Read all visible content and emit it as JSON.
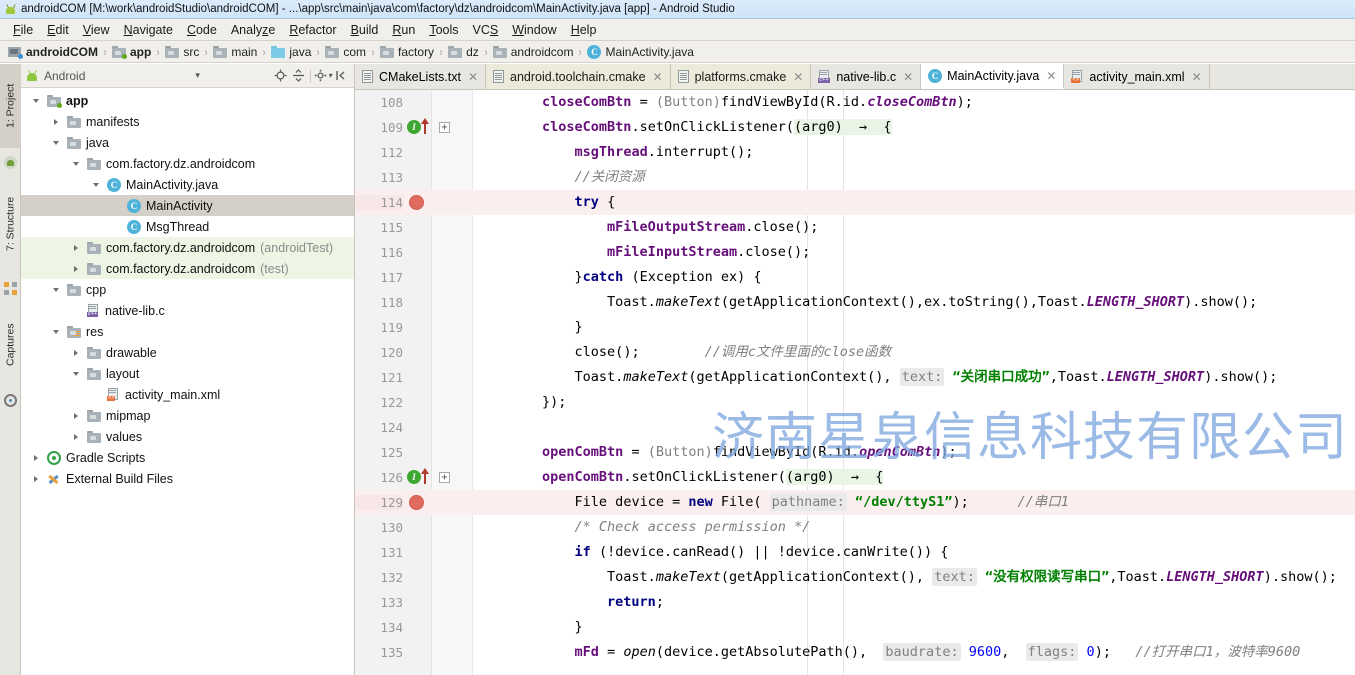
{
  "window": {
    "title": "androidCOM [M:\\work\\androidStudio\\androidCOM] - ...\\app\\src\\main\\java\\com\\factory\\dz\\androidcom\\MainActivity.java [app] - Android Studio",
    "app_icon": "android-studio-icon"
  },
  "menubar": {
    "items": [
      {
        "label": "File",
        "mnemonic": "F"
      },
      {
        "label": "Edit",
        "mnemonic": "E"
      },
      {
        "label": "View",
        "mnemonic": "V"
      },
      {
        "label": "Navigate",
        "mnemonic": "N"
      },
      {
        "label": "Code",
        "mnemonic": "C"
      },
      {
        "label": "Analyze",
        "mnemonic": "z"
      },
      {
        "label": "Refactor",
        "mnemonic": "R"
      },
      {
        "label": "Build",
        "mnemonic": "B"
      },
      {
        "label": "Run",
        "mnemonic": "R"
      },
      {
        "label": "Tools",
        "mnemonic": "T"
      },
      {
        "label": "VCS",
        "mnemonic": "S"
      },
      {
        "label": "Window",
        "mnemonic": "W"
      },
      {
        "label": "Help",
        "mnemonic": "H"
      }
    ]
  },
  "breadcrumb": {
    "items": [
      {
        "label": "androidCOM",
        "icon": "project-icon",
        "bold": true
      },
      {
        "label": "app",
        "icon": "module-folder-icon",
        "bold": true
      },
      {
        "label": "src",
        "icon": "folder-icon",
        "bold": false
      },
      {
        "label": "main",
        "icon": "folder-icon",
        "bold": false
      },
      {
        "label": "java",
        "icon": "source-folder-icon",
        "bold": false
      },
      {
        "label": "com",
        "icon": "package-folder-icon",
        "bold": false
      },
      {
        "label": "factory",
        "icon": "package-folder-icon",
        "bold": false
      },
      {
        "label": "dz",
        "icon": "package-folder-icon",
        "bold": false
      },
      {
        "label": "androidcom",
        "icon": "package-folder-icon",
        "bold": false
      },
      {
        "label": "MainActivity.java",
        "icon": "java-class-icon",
        "bold": false
      }
    ],
    "separator": "›"
  },
  "toolstrip": {
    "left_tabs": [
      {
        "label": "1: Project",
        "active": true
      },
      {
        "label": "7: Structure",
        "active": false
      },
      {
        "label": "Captures",
        "active": false
      }
    ]
  },
  "project_panel": {
    "header": {
      "title": "Android",
      "dropdown_arrow": "chevron-down-icon",
      "buttons": [
        "locate-icon",
        "collapse-all-icon",
        "settings-icon",
        "hide-icon"
      ]
    },
    "tree": [
      {
        "label": "app",
        "indent": 0,
        "expander": "down",
        "icon": "module-folder-icon",
        "bold": true,
        "dim": "",
        "state": ""
      },
      {
        "label": "manifests",
        "indent": 1,
        "expander": "right",
        "icon": "folder-icon",
        "bold": false,
        "dim": "",
        "state": ""
      },
      {
        "label": "java",
        "indent": 1,
        "expander": "down",
        "icon": "folder-icon",
        "bold": false,
        "dim": "",
        "state": ""
      },
      {
        "label": "com.factory.dz.androidcom",
        "indent": 2,
        "expander": "down",
        "icon": "package-folder-icon",
        "bold": false,
        "dim": "",
        "state": ""
      },
      {
        "label": "MainActivity.java",
        "indent": 3,
        "expander": "down",
        "icon": "java-class-icon",
        "bold": false,
        "dim": "",
        "state": ""
      },
      {
        "label": "MainActivity",
        "indent": 4,
        "expander": "none",
        "icon": "java-class-icon",
        "bold": false,
        "dim": "",
        "state": "selected"
      },
      {
        "label": "MsgThread",
        "indent": 4,
        "expander": "none",
        "icon": "java-class-icon",
        "bold": false,
        "dim": "",
        "state": ""
      },
      {
        "label": "com.factory.dz.androidcom",
        "indent": 2,
        "expander": "right",
        "icon": "package-folder-icon",
        "bold": false,
        "dim": "(androidTest)",
        "state": "test"
      },
      {
        "label": "com.factory.dz.androidcom",
        "indent": 2,
        "expander": "right",
        "icon": "package-folder-icon",
        "bold": false,
        "dim": "(test)",
        "state": "test"
      },
      {
        "label": "cpp",
        "indent": 1,
        "expander": "down",
        "icon": "folder-icon",
        "bold": false,
        "dim": "",
        "state": ""
      },
      {
        "label": "native-lib.c",
        "indent": 2,
        "expander": "none",
        "icon": "cpp-file-icon",
        "bold": false,
        "dim": "",
        "state": ""
      },
      {
        "label": "res",
        "indent": 1,
        "expander": "down",
        "icon": "res-folder-icon",
        "bold": false,
        "dim": "",
        "state": ""
      },
      {
        "label": "drawable",
        "indent": 2,
        "expander": "right",
        "icon": "package-folder-icon",
        "bold": false,
        "dim": "",
        "state": ""
      },
      {
        "label": "layout",
        "indent": 2,
        "expander": "down",
        "icon": "package-folder-icon",
        "bold": false,
        "dim": "",
        "state": ""
      },
      {
        "label": "activity_main.xml",
        "indent": 3,
        "expander": "none",
        "icon": "xml-file-icon",
        "bold": false,
        "dim": "",
        "state": ""
      },
      {
        "label": "mipmap",
        "indent": 2,
        "expander": "right",
        "icon": "package-folder-icon",
        "bold": false,
        "dim": "",
        "state": ""
      },
      {
        "label": "values",
        "indent": 2,
        "expander": "right",
        "icon": "package-folder-icon",
        "bold": false,
        "dim": "",
        "state": ""
      },
      {
        "label": "Gradle Scripts",
        "indent": 0,
        "expander": "right",
        "icon": "gradle-icon",
        "bold": false,
        "dim": "",
        "state": ""
      },
      {
        "label": "External Build Files",
        "indent": 0,
        "expander": "right",
        "icon": "external-build-icon",
        "bold": false,
        "dim": "",
        "state": ""
      }
    ]
  },
  "editor_tabs": [
    {
      "label": "CMakeLists.txt",
      "icon": "cmake-file-icon",
      "style": "plain",
      "active": false
    },
    {
      "label": "android.toolchain.cmake",
      "icon": "cmake-file-icon",
      "style": "cmake",
      "active": false
    },
    {
      "label": "platforms.cmake",
      "icon": "cmake-file-icon",
      "style": "cmake",
      "active": false
    },
    {
      "label": "native-lib.c",
      "icon": "cpp-file-icon",
      "style": "plain",
      "active": false
    },
    {
      "label": "MainActivity.java",
      "icon": "java-class-icon",
      "style": "plain",
      "active": true
    },
    {
      "label": "activity_main.xml",
      "icon": "xml-file-icon",
      "style": "plain",
      "active": false
    }
  ],
  "watermark": "济南星泉信息科技有限公司",
  "editor": {
    "lines": [
      {
        "num": "108",
        "hl": false,
        "gutter": "",
        "fold": false,
        "tokens": [
          {
            "t": "        ",
            "c": "plain"
          },
          {
            "t": "closeComBtn",
            "c": "fld"
          },
          {
            "t": " = ",
            "c": "plain"
          },
          {
            "t": "(Button)",
            "c": "cast"
          },
          {
            "t": "findViewById(R.",
            "c": "plain"
          },
          {
            "t": "id",
            "c": "plain"
          },
          {
            "t": ".",
            "c": "plain"
          },
          {
            "t": "closeComBtn",
            "c": "stat"
          },
          {
            "t": ");",
            "c": "plain"
          }
        ]
      },
      {
        "num": "109",
        "hl": false,
        "gutter": "run",
        "fold": true,
        "tokens": [
          {
            "t": "        ",
            "c": "plain"
          },
          {
            "t": "closeComBtn",
            "c": "fld"
          },
          {
            "t": ".setOnClickListener(",
            "c": "plain"
          },
          {
            "t": "(arg0)  →  {",
            "c": "lamb"
          }
        ]
      },
      {
        "num": "112",
        "hl": false,
        "gutter": "",
        "fold": false,
        "tokens": [
          {
            "t": "            ",
            "c": "plain"
          },
          {
            "t": "msgThread",
            "c": "fld"
          },
          {
            "t": ".interrupt();",
            "c": "plain"
          }
        ]
      },
      {
        "num": "113",
        "hl": false,
        "gutter": "",
        "fold": false,
        "tokens": [
          {
            "t": "            ",
            "c": "plain"
          },
          {
            "t": "//关闭资源",
            "c": "cmt"
          }
        ]
      },
      {
        "num": "114",
        "hl": true,
        "gutter": "bp",
        "fold": false,
        "tokens": [
          {
            "t": "            ",
            "c": "plain"
          },
          {
            "t": "try",
            "c": "kw"
          },
          {
            "t": " {",
            "c": "plain"
          }
        ]
      },
      {
        "num": "115",
        "hl": false,
        "gutter": "",
        "fold": false,
        "tokens": [
          {
            "t": "                ",
            "c": "plain"
          },
          {
            "t": "mFileOutputStream",
            "c": "fld"
          },
          {
            "t": ".close();",
            "c": "plain"
          }
        ]
      },
      {
        "num": "116",
        "hl": false,
        "gutter": "",
        "fold": false,
        "tokens": [
          {
            "t": "                ",
            "c": "plain"
          },
          {
            "t": "mFileInputStream",
            "c": "fld"
          },
          {
            "t": ".close();",
            "c": "plain"
          }
        ]
      },
      {
        "num": "117",
        "hl": false,
        "gutter": "",
        "fold": false,
        "tokens": [
          {
            "t": "            }",
            "c": "plain"
          },
          {
            "t": "catch",
            "c": "kw"
          },
          {
            "t": " (Exception ex) {",
            "c": "plain"
          }
        ]
      },
      {
        "num": "118",
        "hl": false,
        "gutter": "",
        "fold": false,
        "tokens": [
          {
            "t": "                ",
            "c": "plain"
          },
          {
            "t": "Toast.",
            "c": "plain"
          },
          {
            "t": "makeText",
            "c": "mth"
          },
          {
            "t": "(getApplicationContext(),ex.toString(),Toast.",
            "c": "plain"
          },
          {
            "t": "LENGTH_SHORT",
            "c": "stat"
          },
          {
            "t": ").show();",
            "c": "plain"
          }
        ]
      },
      {
        "num": "119",
        "hl": false,
        "gutter": "",
        "fold": false,
        "tokens": [
          {
            "t": "            }",
            "c": "plain"
          }
        ]
      },
      {
        "num": "120",
        "hl": false,
        "gutter": "",
        "fold": false,
        "tokens": [
          {
            "t": "            ",
            "c": "plain"
          },
          {
            "t": "close();",
            "c": "plain"
          },
          {
            "t": "        ",
            "c": "plain"
          },
          {
            "t": "//调用c文件里面的close函数",
            "c": "cmt"
          }
        ]
      },
      {
        "num": "121",
        "hl": false,
        "gutter": "",
        "fold": false,
        "tokens": [
          {
            "t": "            ",
            "c": "plain"
          },
          {
            "t": "Toast.",
            "c": "plain"
          },
          {
            "t": "makeText",
            "c": "mth"
          },
          {
            "t": "(getApplicationContext(), ",
            "c": "plain"
          },
          {
            "t": "text:",
            "c": "hint"
          },
          {
            "t": " ",
            "c": "plain"
          },
          {
            "t": "“关闭串口成功”",
            "c": "str"
          },
          {
            "t": ",Toast.",
            "c": "plain"
          },
          {
            "t": "LENGTH_SHORT",
            "c": "stat"
          },
          {
            "t": ").show();",
            "c": "plain"
          }
        ]
      },
      {
        "num": "122",
        "hl": false,
        "gutter": "",
        "fold": false,
        "tokens": [
          {
            "t": "        ",
            "c": "plain"
          },
          {
            "t": "});",
            "c": "plain"
          }
        ]
      },
      {
        "num": "124",
        "hl": false,
        "gutter": "",
        "fold": false,
        "tokens": []
      },
      {
        "num": "125",
        "hl": false,
        "gutter": "",
        "fold": false,
        "tokens": [
          {
            "t": "        ",
            "c": "plain"
          },
          {
            "t": "openComBtn",
            "c": "fld"
          },
          {
            "t": " = ",
            "c": "plain"
          },
          {
            "t": "(Button)",
            "c": "cast"
          },
          {
            "t": "findViewById(R.",
            "c": "plain"
          },
          {
            "t": "id",
            "c": "plain"
          },
          {
            "t": ".",
            "c": "plain"
          },
          {
            "t": "openComBtn",
            "c": "stat"
          },
          {
            "t": ");",
            "c": "plain"
          }
        ]
      },
      {
        "num": "126",
        "hl": false,
        "gutter": "run",
        "fold": true,
        "tokens": [
          {
            "t": "        ",
            "c": "plain"
          },
          {
            "t": "openComBtn",
            "c": "fld"
          },
          {
            "t": ".setOnClickListener(",
            "c": "plain"
          },
          {
            "t": "(arg0)  →  {",
            "c": "lamb"
          }
        ]
      },
      {
        "num": "129",
        "hl": true,
        "gutter": "bp",
        "fold": false,
        "tokens": [
          {
            "t": "            ",
            "c": "plain"
          },
          {
            "t": "File device = ",
            "c": "plain"
          },
          {
            "t": "new",
            "c": "kw"
          },
          {
            "t": " File( ",
            "c": "plain"
          },
          {
            "t": "pathname:",
            "c": "hint"
          },
          {
            "t": " ",
            "c": "plain"
          },
          {
            "t": "“/dev/ttyS1”",
            "c": "str"
          },
          {
            "t": ");",
            "c": "plain"
          },
          {
            "t": "      ",
            "c": "plain"
          },
          {
            "t": "//串口1",
            "c": "cmt"
          }
        ]
      },
      {
        "num": "130",
        "hl": false,
        "gutter": "",
        "fold": false,
        "tokens": [
          {
            "t": "            ",
            "c": "plain"
          },
          {
            "t": "/* Check access permission */",
            "c": "cmt"
          }
        ]
      },
      {
        "num": "131",
        "hl": false,
        "gutter": "",
        "fold": false,
        "tokens": [
          {
            "t": "            ",
            "c": "plain"
          },
          {
            "t": "if",
            "c": "kw"
          },
          {
            "t": " (!device.canRead() || !device.canWrite()) {",
            "c": "plain"
          }
        ]
      },
      {
        "num": "132",
        "hl": false,
        "gutter": "",
        "fold": false,
        "tokens": [
          {
            "t": "                ",
            "c": "plain"
          },
          {
            "t": "Toast.",
            "c": "plain"
          },
          {
            "t": "makeText",
            "c": "mth"
          },
          {
            "t": "(getApplicationContext(), ",
            "c": "plain"
          },
          {
            "t": "text:",
            "c": "hint"
          },
          {
            "t": " ",
            "c": "plain"
          },
          {
            "t": "“没有权限读写串口”",
            "c": "str"
          },
          {
            "t": ",Toast.",
            "c": "plain"
          },
          {
            "t": "LENGTH_SHORT",
            "c": "stat"
          },
          {
            "t": ").show();",
            "c": "plain"
          }
        ]
      },
      {
        "num": "133",
        "hl": false,
        "gutter": "",
        "fold": false,
        "tokens": [
          {
            "t": "                ",
            "c": "plain"
          },
          {
            "t": "return",
            "c": "kw"
          },
          {
            "t": ";",
            "c": "plain"
          }
        ]
      },
      {
        "num": "134",
        "hl": false,
        "gutter": "",
        "fold": false,
        "tokens": [
          {
            "t": "            }",
            "c": "plain"
          }
        ]
      },
      {
        "num": "135",
        "hl": false,
        "gutter": "",
        "fold": false,
        "tokens": [
          {
            "t": "            ",
            "c": "plain"
          },
          {
            "t": "mFd",
            "c": "fld"
          },
          {
            "t": " = ",
            "c": "plain"
          },
          {
            "t": "open",
            "c": "mth"
          },
          {
            "t": "(device.getAbsolutePath(),  ",
            "c": "plain"
          },
          {
            "t": "baudrate:",
            "c": "hint"
          },
          {
            "t": " ",
            "c": "plain"
          },
          {
            "t": "9600",
            "c": "num"
          },
          {
            "t": ",  ",
            "c": "plain"
          },
          {
            "t": "flags:",
            "c": "hint"
          },
          {
            "t": " ",
            "c": "plain"
          },
          {
            "t": "0",
            "c": "num"
          },
          {
            "t": ");",
            "c": "plain"
          },
          {
            "t": "   ",
            "c": "plain"
          },
          {
            "t": "//打开串口1，波特率",
            "c": "cmt"
          },
          {
            "t": "9600",
            "c": "cmt"
          }
        ]
      }
    ]
  },
  "colors": {
    "titlebar": "#cfe4f8",
    "chrome": "#f1efeb",
    "selection": "#d4d0c8",
    "test_scope": "#eef5e4",
    "breakpoint": "#e06c5f",
    "string": "#008000",
    "keyword": "#000080",
    "field": "#660e7a",
    "comment": "#808080",
    "watermark": "#7fa9e0"
  }
}
